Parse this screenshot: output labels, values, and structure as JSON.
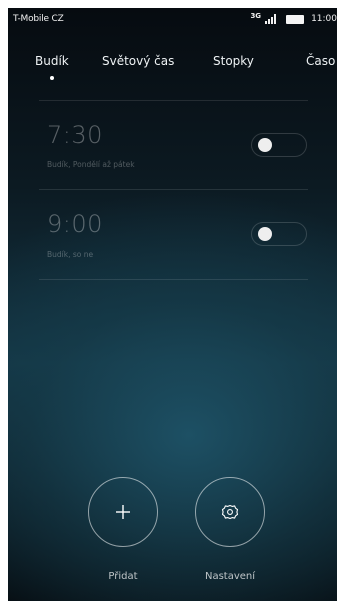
{
  "status_bar": {
    "carrier": "T-Mobile CZ",
    "network": "3G",
    "time": "11:00"
  },
  "tabs": [
    {
      "label": "Budík",
      "active": true
    },
    {
      "label": "Světový čas",
      "active": false
    },
    {
      "label": "Stopky",
      "active": false
    },
    {
      "label": "Časo",
      "active": false
    }
  ],
  "alarms": [
    {
      "time": "7:30",
      "description": "Budík, Pondělí až pátek",
      "enabled": false
    },
    {
      "time": "9:00",
      "description": "Budík, so ne",
      "enabled": false
    }
  ],
  "actions": {
    "add_label": "Přidat",
    "settings_label": "Nastavení"
  },
  "icons": {
    "add": "plus-icon",
    "settings": "gear-icon"
  },
  "colors": {
    "background_top": "#060b10",
    "background_mid": "#133544",
    "text": "#ffffff"
  }
}
